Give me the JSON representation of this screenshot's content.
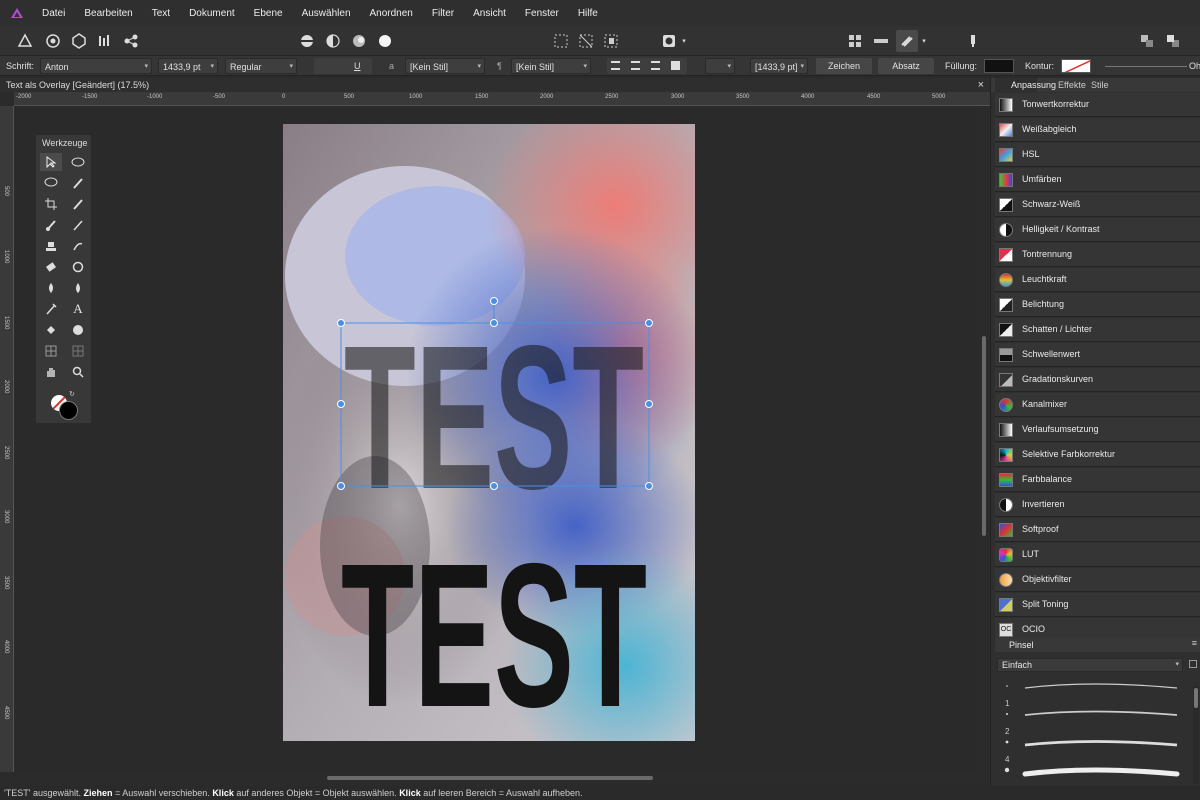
{
  "menubar": {
    "items": [
      "Datei",
      "Bearbeiten",
      "Text",
      "Dokument",
      "Ebene",
      "Auswählen",
      "Anordnen",
      "Filter",
      "Ansicht",
      "Fenster",
      "Hilfe"
    ]
  },
  "context": {
    "font_label": "Schrift:",
    "font": "Anton",
    "size": "1433,9 pt",
    "style": "Regular",
    "char_style": "[Kein Stil]",
    "para_style": "[Kein Stil]",
    "size2": "[1433,9 pt]",
    "zeichen": "Zeichen",
    "absatz": "Absatz",
    "fill_label": "Füllung:",
    "stroke_label": "Kontur:",
    "stroke_off": "Oh"
  },
  "document": {
    "tab_title": "Text als Overlay [Geändert] (17.5%)",
    "close": "×"
  },
  "rulers": {
    "h": [
      "-2000",
      "-1500",
      "-1000",
      "-500",
      "0",
      "500",
      "1000",
      "1500",
      "2000",
      "2500",
      "3000",
      "3500",
      "4000",
      "4500",
      "5000"
    ],
    "v": [
      "500",
      "1000",
      "1500",
      "2000",
      "2500",
      "3000",
      "3500",
      "4000",
      "4500"
    ]
  },
  "canvas": {
    "overlay_text": "TEST",
    "bottom_text": "TEST"
  },
  "tools_panel": {
    "title": "Werkzeuge"
  },
  "right_panel": {
    "tabs": [
      "Anpassung",
      "Effekte",
      "Stile"
    ],
    "adjustments": [
      {
        "label": "Tonwertkorrektur",
        "icon": "levels-icon"
      },
      {
        "label": "Weißabgleich",
        "icon": "white-balance-icon"
      },
      {
        "label": "HSL",
        "icon": "hsl-icon"
      },
      {
        "label": "Umfärben",
        "icon": "recolor-icon"
      },
      {
        "label": "Schwarz-Weiß",
        "icon": "black-white-icon"
      },
      {
        "label": "Helligkeit / Kontrast",
        "icon": "brightness-contrast-icon"
      },
      {
        "label": "Tontrennung",
        "icon": "posterize-icon"
      },
      {
        "label": "Leuchtkraft",
        "icon": "vibrance-icon"
      },
      {
        "label": "Belichtung",
        "icon": "exposure-icon"
      },
      {
        "label": "Schatten / Lichter",
        "icon": "shadows-highlights-icon"
      },
      {
        "label": "Schwellenwert",
        "icon": "threshold-icon"
      },
      {
        "label": "Gradationskurven",
        "icon": "curves-icon"
      },
      {
        "label": "Kanalmixer",
        "icon": "channel-mixer-icon"
      },
      {
        "label": "Verlaufsumsetzung",
        "icon": "gradient-map-icon"
      },
      {
        "label": "Selektive Farbkorrektur",
        "icon": "selective-color-icon"
      },
      {
        "label": "Farbbalance",
        "icon": "color-balance-icon"
      },
      {
        "label": "Invertieren",
        "icon": "invert-icon"
      },
      {
        "label": "Softproof",
        "icon": "soft-proof-icon"
      },
      {
        "label": "LUT",
        "icon": "lut-icon"
      },
      {
        "label": "Objektivfilter",
        "icon": "lens-filter-icon"
      },
      {
        "label": "Split Toning",
        "icon": "split-toning-icon"
      },
      {
        "label": "OCIO",
        "icon": "ocio-icon"
      }
    ],
    "brush_panel": {
      "title": "Pinsel",
      "category": "Einfach",
      "brush_numbers": [
        "1",
        "2",
        "4"
      ]
    }
  },
  "status": {
    "p1": "'TEST' ausgewählt. ",
    "b1": "Ziehen",
    "p2": " = Auswahl verschieben. ",
    "b2": "Klick",
    "p3": " auf anderes Objekt = Objekt auswählen. ",
    "b3": "Klick",
    "p4": " auf leeren Bereich = Auswahl aufheben."
  }
}
